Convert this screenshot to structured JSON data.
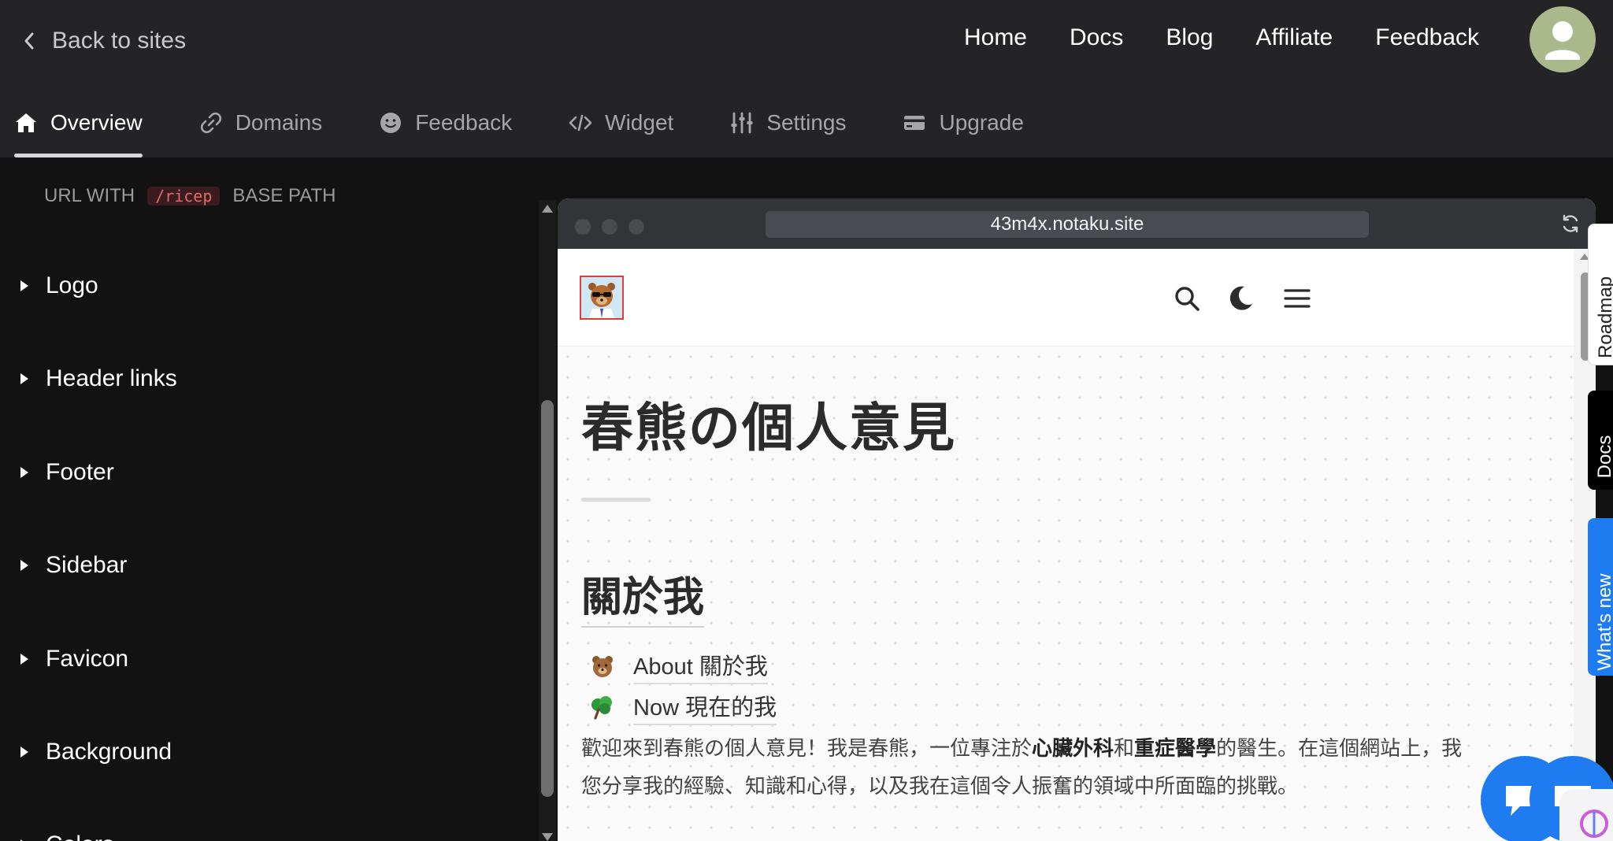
{
  "topbar": {
    "back_label": "Back to sites",
    "nav": [
      "Home",
      "Docs",
      "Blog",
      "Affiliate",
      "Feedback"
    ]
  },
  "tabs": [
    {
      "label": "Overview",
      "icon": "home-icon",
      "active": true
    },
    {
      "label": "Domains",
      "icon": "link-icon",
      "active": false
    },
    {
      "label": "Feedback",
      "icon": "smiley-icon",
      "active": false
    },
    {
      "label": "Widget",
      "icon": "code-icon",
      "active": false
    },
    {
      "label": "Settings",
      "icon": "sliders-icon",
      "active": false
    },
    {
      "label": "Upgrade",
      "icon": "card-icon",
      "active": false
    }
  ],
  "left_panel": {
    "cut_text_a": "URL WITH",
    "cut_code": "/ricep",
    "cut_text_b": "BASE PATH",
    "sections": [
      "Logo",
      "Header links",
      "Footer",
      "Sidebar",
      "Favicon",
      "Background",
      "Colors"
    ]
  },
  "preview": {
    "url": "43m4x.notaku.site",
    "title": "春熊の個人意見",
    "section_heading": "關於我",
    "links": [
      {
        "emoji": "bear",
        "label": "About 關於我"
      },
      {
        "emoji": "tree",
        "label": "Now 現在的我"
      }
    ],
    "paragraph": {
      "line1_a": "歡迎來到春熊の個人意見！我是春熊，一位專注於",
      "bold1": "心臟外科",
      "line1_b": "和",
      "bold2": "重症醫學",
      "line1_c": "的醫生。在這個網站上，我",
      "line2": "您分享我的經驗、知識和心得，以及我在這個令人振奮的領域中所面臨的挑戰。"
    }
  },
  "side_tabs": [
    "Roadmap",
    "Docs",
    "What's new"
  ],
  "colors": {
    "topbar_bg": "#242427",
    "page_bg": "#121212",
    "accent_blue": "#1f7cf0"
  }
}
